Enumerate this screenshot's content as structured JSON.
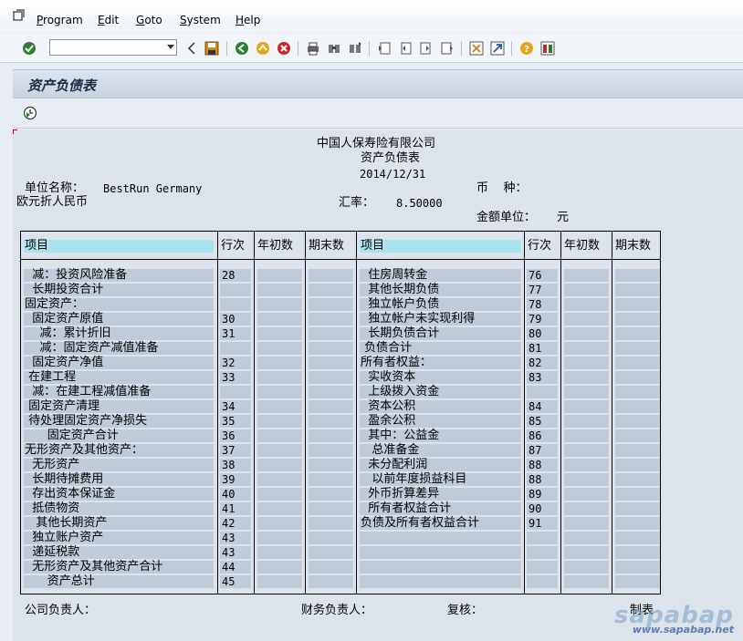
{
  "menu": {
    "items": [
      {
        "label": "Program",
        "mnemonic": "P"
      },
      {
        "label": "Edit",
        "mnemonic": "E"
      },
      {
        "label": "Goto",
        "mnemonic": "G"
      },
      {
        "label": "System",
        "mnemonic": "S"
      },
      {
        "label": "Help",
        "mnemonic": "H"
      }
    ]
  },
  "toolbar": {
    "command_field_value": "",
    "icons": [
      "enter-icon",
      "back-icon",
      "save-icon",
      "exit-icon",
      "up-icon",
      "cancel-icon",
      "print-icon",
      "find-icon",
      "find-next-icon",
      "first-page-icon",
      "prev-page-icon",
      "next-page-icon",
      "last-page-icon",
      "new-session-icon",
      "shortcut-icon",
      "help-icon",
      "layout-icon"
    ]
  },
  "screen": {
    "title": "资产负债表",
    "app_icon": "execute-clock-icon"
  },
  "report": {
    "company": "中国人保寿险有限公司",
    "name": "资产负债表",
    "date": "2014/12/31",
    "unit_label": "单位名称：",
    "unit_value": "BestRun Germany",
    "currency_label": "币    种：",
    "conversion_note": "欧元折人民币",
    "rate_label": "汇率：",
    "rate_value": "8.50000",
    "amount_unit_label": "金额单位：",
    "amount_unit_value": "元",
    "headers": {
      "item": "项目",
      "line": "行次",
      "begin": "年初数",
      "end": "期末数"
    },
    "left_rows": [
      {
        "text": "  减：投资风险准备",
        "line": "28"
      },
      {
        "text": "  长期投资合计",
        "line": ""
      },
      {
        "text": "固定资产：",
        "line": ""
      },
      {
        "text": "  固定资产原值",
        "line": "30"
      },
      {
        "text": "    减：累计折旧",
        "line": "31"
      },
      {
        "text": "    减：固定资产减值准备",
        "line": ""
      },
      {
        "text": "  固定资产净值",
        "line": "32"
      },
      {
        "text": " 在建工程",
        "line": "33"
      },
      {
        "text": "  减：在建工程减值准备",
        "line": ""
      },
      {
        "text": " 固定资产清理",
        "line": "34"
      },
      {
        "text": " 待处理固定资产净损失",
        "line": "35"
      },
      {
        "text": "      固定资产合计",
        "line": "36"
      },
      {
        "text": "无形资产及其他资产：",
        "line": "37"
      },
      {
        "text": "  无形资产",
        "line": "38"
      },
      {
        "text": "  长期待摊费用",
        "line": "39"
      },
      {
        "text": "  存出资本保证金",
        "line": "40"
      },
      {
        "text": "  抵债物资",
        "line": "41"
      },
      {
        "text": "   其他长期资产",
        "line": "42"
      },
      {
        "text": "  独立账户资产",
        "line": "43"
      },
      {
        "text": "  递延税款",
        "line": "43"
      },
      {
        "text": "  无形资产及其他资产合计",
        "line": "44"
      },
      {
        "text": "      资产总计",
        "line": "45"
      }
    ],
    "right_rows": [
      {
        "text": "  住房周转金",
        "line": "76"
      },
      {
        "text": "  其他长期负债",
        "line": "77"
      },
      {
        "text": "  独立帐户负债",
        "line": "78"
      },
      {
        "text": "  独立帐户未实现利得",
        "line": "79"
      },
      {
        "text": "  长期负债合计",
        "line": "80"
      },
      {
        "text": " 负债合计",
        "line": "81"
      },
      {
        "text": "所有者权益：",
        "line": "82"
      },
      {
        "text": "  实收资本",
        "line": "83"
      },
      {
        "text": "  上级拨入资金",
        "line": ""
      },
      {
        "text": "  资本公积",
        "line": "84"
      },
      {
        "text": "  盈余公积",
        "line": "85"
      },
      {
        "text": "  其中：公益金",
        "line": "86"
      },
      {
        "text": "   总准备金",
        "line": "87"
      },
      {
        "text": "  未分配利润",
        "line": "88"
      },
      {
        "text": "   以前年度损益科目",
        "line": "88"
      },
      {
        "text": "  外币折算差异",
        "line": "89"
      },
      {
        "text": "  所有者权益合计",
        "line": "90"
      },
      {
        "text": "负债及所有者权益合计",
        "line": "91"
      },
      {
        "text": "",
        "line": ""
      },
      {
        "text": "",
        "line": ""
      },
      {
        "text": "",
        "line": ""
      },
      {
        "text": "",
        "line": ""
      }
    ],
    "footer": {
      "responsible": "公司负责人：",
      "finance": "财务负责人：",
      "review": "复核：",
      "prepared": "制表"
    }
  },
  "watermark": {
    "brand": "sapabap",
    "url": "www.sapabap.net"
  }
}
